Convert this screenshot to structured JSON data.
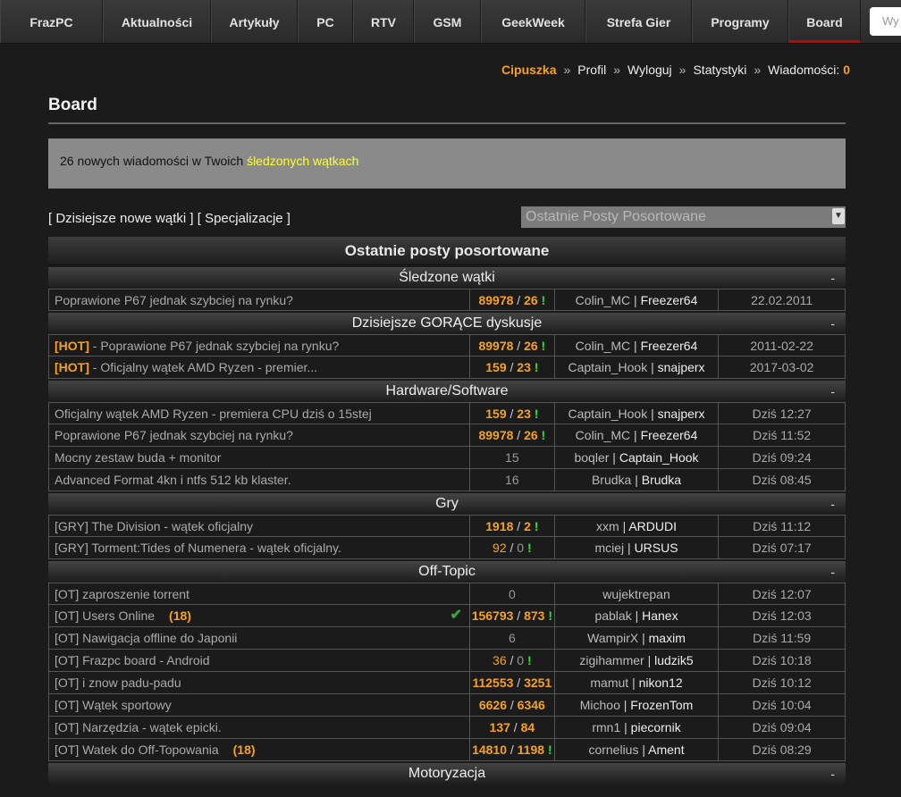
{
  "nav": [
    "FrazPC",
    "Aktualności",
    "Artykuły",
    "PC",
    "RTV",
    "GSM",
    "GeekWeek",
    "Strefa Gier",
    "Programy",
    "Board"
  ],
  "search_placeholder": "Wy",
  "userline": {
    "user": "Cipuszka",
    "profile": "Profil",
    "logout": "Wyloguj",
    "stats": "Statystyki",
    "messages": "Wiadomości:",
    "messages_count": "0",
    "sep": "»"
  },
  "board_title": "Board",
  "notice": {
    "text": "26 nowych wiadomości w Twoich ",
    "link": "śledzonych wątkach"
  },
  "links": {
    "today": "[ Dzisiejsze nowe wątki ]",
    "spec": "[ Specjalizacje ]"
  },
  "select_value": "Ostatnie Posty Posortowane",
  "table_title": "Ostatnie posty posortowane",
  "collapse_label": "-",
  "sections": [
    {
      "title": "Śledzone wątki",
      "rows": [
        {
          "topic": "Poprawione P67 jednak szybciej na rynku?",
          "views": "89978",
          "replies": "26",
          "excl": "!",
          "hot_stat": true,
          "author": "Colin_MC",
          "last": "Freezer64",
          "date": "22.02.2011"
        }
      ]
    },
    {
      "title": "Dzisiejsze GORĄCE dyskusje",
      "rows": [
        {
          "hot": "[HOT]",
          "topic": " - Poprawione P67 jednak szybciej na rynku?",
          "views": "89978",
          "replies": "26",
          "excl": "!",
          "hot_stat": true,
          "author": "Colin_MC",
          "last": "Freezer64",
          "date": "2011-02-22"
        },
        {
          "hot": "[HOT]",
          "topic": " - Oficjalny wątek AMD Ryzen - premier...",
          "views": "159",
          "replies": "23",
          "excl": "!",
          "hot_stat": true,
          "author": "Captain_Hook",
          "last": "snajperx",
          "date": "2017-03-02"
        }
      ]
    },
    {
      "title": "Hardware/Software",
      "rows": [
        {
          "topic": "Oficjalny wątek AMD Ryzen - premiera CPU dziś o 15stej",
          "views": "159",
          "replies": "23",
          "excl": "!",
          "hot_stat": true,
          "author": "Captain_Hook",
          "last": "snajperx",
          "date": "Dziś 12:27"
        },
        {
          "topic": "Poprawione P67 jednak szybciej na rynku?",
          "views": "89978",
          "replies": "26",
          "excl": "!",
          "hot_stat": true,
          "author": "Colin_MC",
          "last": "Freezer64",
          "date": "Dziś 11:52"
        },
        {
          "topic": "Mocny zestaw buda + monitor",
          "plain": "15",
          "author": "boqler",
          "last": "Captain_Hook",
          "date": "Dziś 09:24"
        },
        {
          "topic": "Advanced Format 4kn i ntfs 512 kb klaster.",
          "plain": "16",
          "author": "Brudka",
          "last": "Brudka",
          "date": "Dziś 08:45"
        }
      ]
    },
    {
      "title": "Gry",
      "rows": [
        {
          "topic": "[GRY] The Division - wątek oficjalny",
          "views": "1918",
          "replies": "2",
          "excl": "!",
          "hot_stat": true,
          "author": "xxm",
          "last": "ARDUDI",
          "date": "Dziś 11:12"
        },
        {
          "topic": "[GRY] Torment:Tides of Numenera - wątek oficjalny.",
          "views": "92",
          "replies": "0",
          "excl": "!",
          "hot_stat": false,
          "author": "mciej",
          "last": "URSUS",
          "date": "Dziś 07:17"
        }
      ]
    },
    {
      "title": "Off-Topic",
      "rows": [
        {
          "topic": "[OT] zaproszenie torrent",
          "plain": "0",
          "author": "wujektrepan",
          "last": "",
          "date": "Dziś 12:07"
        },
        {
          "topic": "[OT] Users Online",
          "users": "(18)",
          "check": "✔",
          "views": "156793",
          "replies": "873",
          "excl": "!",
          "hot_stat": true,
          "author": "pablak",
          "last": "Hanex",
          "date": "Dziś 12:03"
        },
        {
          "topic": "[OT] Nawigacja offline do Japonii",
          "plain": "6",
          "author": "WampirX",
          "last": "maxim",
          "date": "Dziś 11:59"
        },
        {
          "topic": "[OT] Frazpc board - Android",
          "views": "36",
          "replies": "0",
          "excl": "!",
          "hot_stat": false,
          "author": "zigihammer",
          "last": "ludzik5",
          "date": "Dziś 10:18"
        },
        {
          "topic": "[OT] i znow padu-padu",
          "views": "112553",
          "replies": "3251",
          "hot_stat": true,
          "author": "mamut",
          "last": "nikon12",
          "date": "Dziś 10:12"
        },
        {
          "topic": "[OT] Wątek sportowy",
          "views": "6626",
          "replies": "6346",
          "hot_stat": true,
          "author": "Michoo",
          "last": "FrozenTom",
          "date": "Dziś 10:04"
        },
        {
          "topic": "[OT] Narzędzia - wątek epicki.",
          "views": "137",
          "replies": "84",
          "hot_stat": true,
          "author": "rmn1",
          "last": "piecornik",
          "date": "Dziś 09:04"
        },
        {
          "topic": "[OT] Watek do Off-Topowania",
          "users": "(18)",
          "views": "14810",
          "replies": "1198",
          "excl": "!",
          "hot_stat": true,
          "author": "cornelius",
          "last": "Ament",
          "date": "Dziś 08:29"
        }
      ]
    },
    {
      "title": "Motoryzacja",
      "rows": []
    }
  ]
}
